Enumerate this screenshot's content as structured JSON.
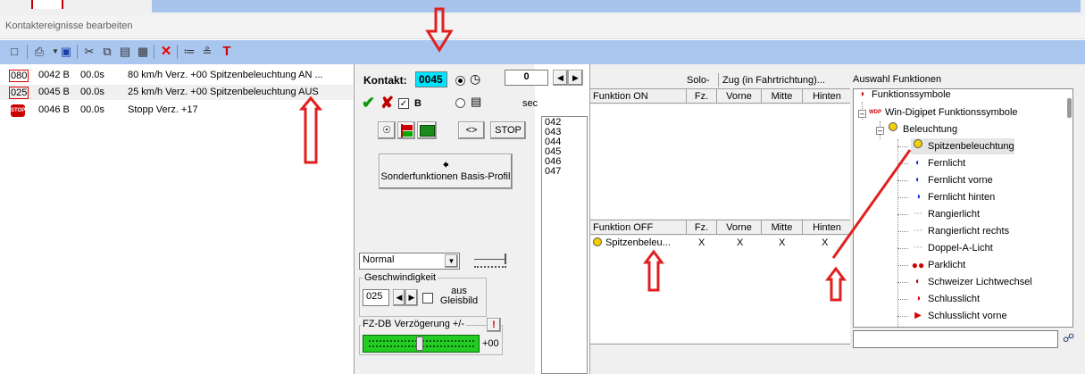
{
  "window": {
    "title": "Kontaktereignisse bearbeiten"
  },
  "toolbar": {
    "icons": [
      "new-icon",
      "print-icon",
      "save-icon",
      "cut-icon",
      "copy-icon",
      "paste-icon",
      "clipboard-icon",
      "delete-icon",
      "insert-row-icon",
      "remove-row-icon",
      "text-tool-icon"
    ]
  },
  "events": [
    {
      "speed": "080",
      "contact": "0042 B",
      "time": "00.0s",
      "desc": "80 km/h Verz. +00 Spitzenbeleuchtung AN ..."
    },
    {
      "speed": "025",
      "contact": "0045 B",
      "time": "00.0s",
      "desc": "25 km/h Verz. +00 Spitzenbeleuchtung AUS"
    },
    {
      "speed": "STOP",
      "contact": "0046 B",
      "time": "00.0s",
      "desc": "Stopp Verz. +17"
    }
  ],
  "contact": {
    "label": "Kontakt:",
    "value": "0045",
    "timer_value": "0",
    "b_label": "B",
    "sec_label": "sec",
    "stop_label": "STOP",
    "arrows_label": "<>",
    "sonder_label": "Sonderfunktionen Basis-Profil",
    "mode_value": "Normal",
    "speed_group_label": "Geschwindigkeit",
    "speed_value": "025",
    "aus_label": "aus Gleisbild",
    "delay_group_label": "FZ-DB Verzögerung +/-",
    "delay_value": "+00",
    "warn_label": "!"
  },
  "numbers": [
    "042",
    "043",
    "044",
    "045",
    "046",
    "047"
  ],
  "functions": {
    "solo_label": "Solo-",
    "zug_label": "Zug (in Fahrtrichtung)...",
    "on_headers": [
      "Funktion ON",
      "Fz.",
      "Vorne",
      "Mitte",
      "Hinten"
    ],
    "off_headers": [
      "Funktion OFF",
      "Fz.",
      "Vorne",
      "Mitte",
      "Hinten"
    ],
    "off_rows": [
      {
        "name": "Spitzenbeleu...",
        "fz": "X",
        "vorne": "X",
        "mitte": "X",
        "hinten": "X"
      }
    ]
  },
  "tree": {
    "title": "Auswahl Funktionen",
    "nodes": [
      "Funktionssymbole",
      "Win-Digipet Funktionssymbole",
      "Beleuchtung",
      "Spitzenbeleuchtung",
      "Fernlicht",
      "Fernlicht vorne",
      "Fernlicht hinten",
      "Rangierlicht",
      "Rangierlicht rechts",
      "Doppel-A-Licht",
      "Parklicht",
      "Schweizer Lichtwechsel",
      "Schlusslicht",
      "Schlusslicht vorne"
    ],
    "wdp_badge": "WDP"
  },
  "colors": {
    "toolbar": "#a9c6ee",
    "contact_highlight": "#00e5ff",
    "annotation": "#e02020",
    "delay_bar": "#22cc22"
  }
}
